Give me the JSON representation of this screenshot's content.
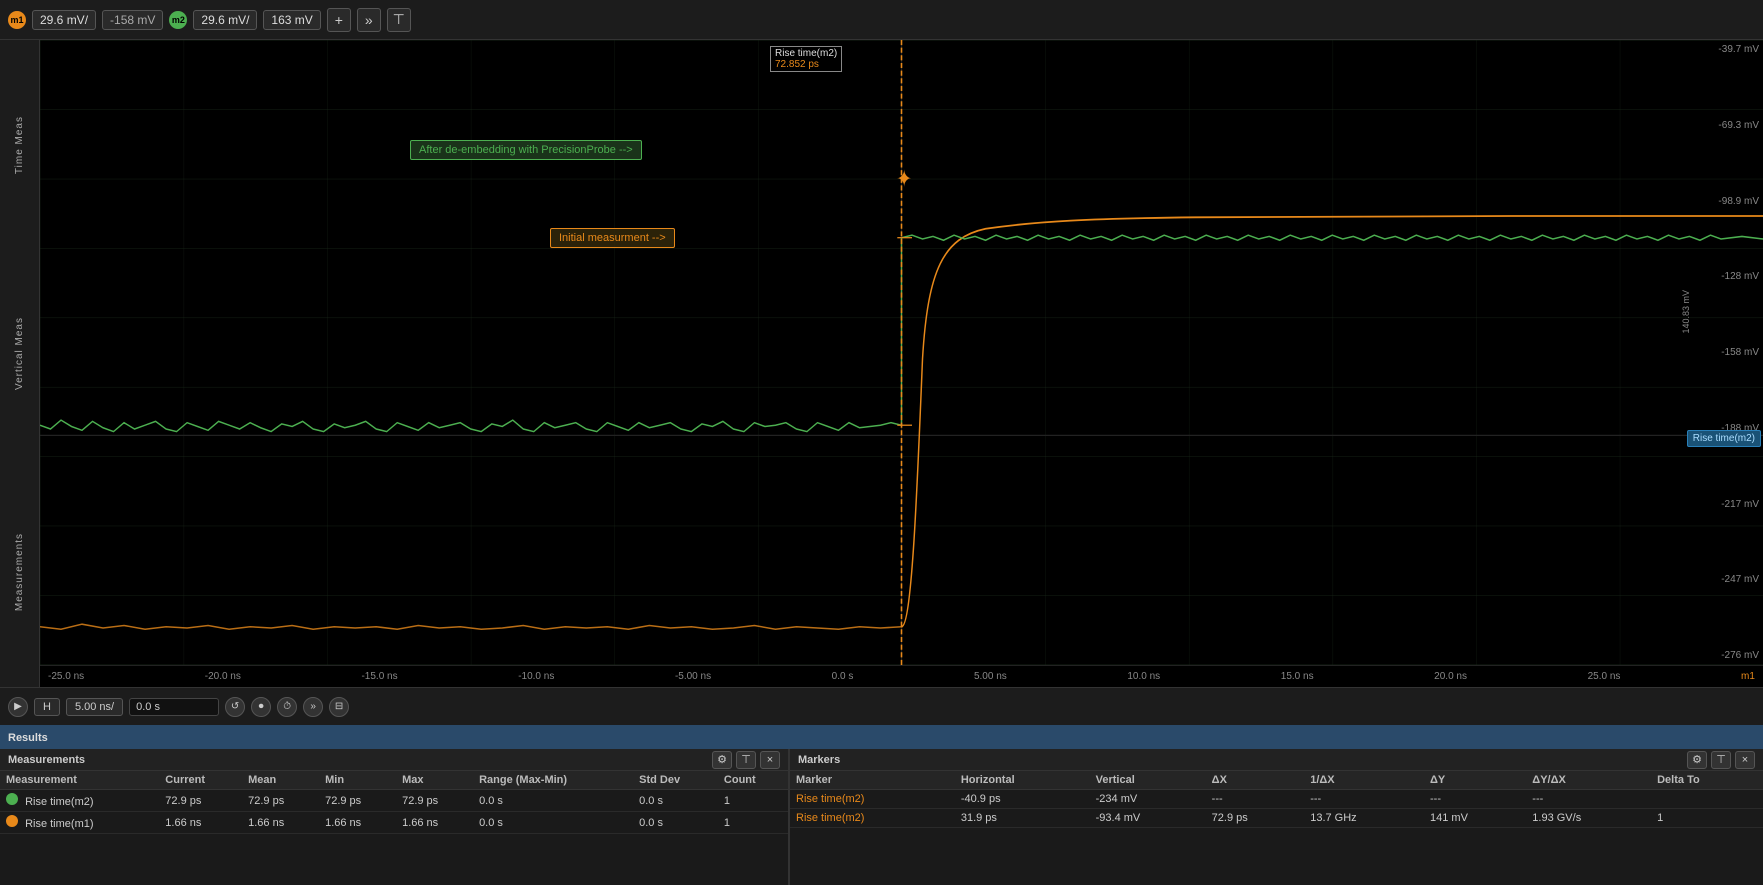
{
  "toolbar": {
    "ch1_badge": "m1",
    "ch1_volt1": "29.6 mV/",
    "ch1_volt2": "-158 mV",
    "ch2_badge": "m2",
    "ch2_volt1": "29.6 mV/",
    "ch2_volt2": "163 mV",
    "plus_icon": "+",
    "forward_icon": "»",
    "pin_icon": "⊤"
  },
  "scope": {
    "annotation_green": "After de-embedding with PrecisionProbe -->",
    "annotation_orange": "Initial measurment -->",
    "rise_time_label_top": "Rise time(m2)",
    "rise_time_value": "72.852 ps",
    "rise_time_label_right": "Rise time(m2)",
    "right_labels": [
      "-39.7 mV",
      "-69.3 mV",
      "-98.9 mV",
      "-128 mV",
      "-158 mV",
      "-188 mV",
      "-217 mV",
      "-247 mV",
      "-276 mV"
    ],
    "right_vert_label": "140.83 mV",
    "time_labels": [
      "-25.0 ns",
      "-20.0 ns",
      "-15.0 ns",
      "-10.0 ns",
      "-5.00 ns",
      "0.0 s",
      "5.00 ns",
      "10.0 ns",
      "15.0 ns",
      "20.0 ns",
      "25.0 ns",
      "m1"
    ]
  },
  "bottom_toolbar": {
    "h_label": "H",
    "time_per_div": "5.00 ns/",
    "time_offset": "0.0 s"
  },
  "results": {
    "title": "Results",
    "measurements_title": "Measurements",
    "markers_title": "Markers",
    "gear_icon": "⚙",
    "pin_icon": "⊤",
    "close_icon": "×",
    "meas_columns": [
      "Measurement",
      "Current",
      "Mean",
      "Min",
      "Max",
      "Range (Max-Min)",
      "Std Dev",
      "Count"
    ],
    "meas_rows": [
      {
        "channel": "green",
        "name": "Rise time(m2)",
        "current": "72.9 ps",
        "mean": "72.9 ps",
        "min": "72.9 ps",
        "max": "72.9 ps",
        "range": "0.0 s",
        "std_dev": "0.0 s",
        "count": "1"
      },
      {
        "channel": "orange",
        "name": "Rise time(m1)",
        "current": "1.66 ns",
        "mean": "1.66 ns",
        "min": "1.66 ns",
        "max": "1.66 ns",
        "range": "0.0 s",
        "std_dev": "0.0 s",
        "count": "1"
      }
    ],
    "marker_columns": [
      "Marker",
      "Horizontal",
      "Vertical",
      "ΔX",
      "1/ΔX",
      "ΔY",
      "ΔY/ΔX",
      "Delta To"
    ],
    "marker_rows": [
      {
        "name": "Rise time(m2)",
        "horizontal": "-40.9 ps",
        "vertical": "-234 mV",
        "dx": "---",
        "inv_dx": "---",
        "dy": "---",
        "dy_dx": "---",
        "delta_to": ""
      },
      {
        "name": "Rise time(m2)",
        "horizontal": "31.9 ps",
        "vertical": "-93.4 mV",
        "dx": "72.9 ps",
        "inv_dx": "13.7 GHz",
        "dy": "141 mV",
        "dy_dx": "1.93 GV/s",
        "delta_to": "1"
      }
    ]
  },
  "side_labels": {
    "time_meas": "Time Meas",
    "vertical_meas": "Vertical Meas",
    "measurements": "Measurements"
  }
}
